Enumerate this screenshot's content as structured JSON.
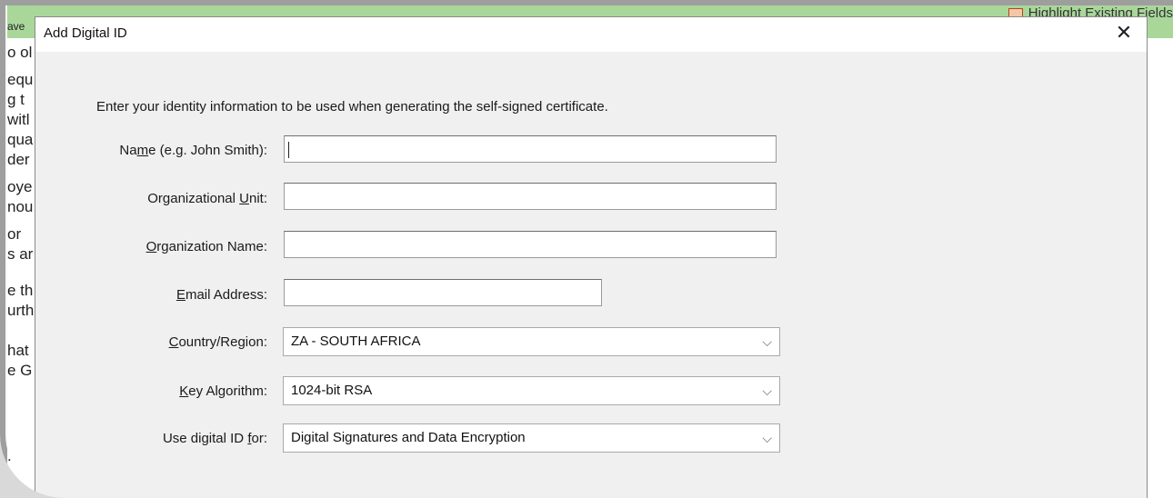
{
  "background": {
    "top_left_text": "ave",
    "highlight_button": "Highlight Existing Fields",
    "doc_lines": [
      "o ol",
      "equ",
      "g t",
      "witl",
      "qua",
      "der",
      "oye",
      "nou",
      "or",
      "s ar",
      "e th",
      "urth",
      "hat",
      "e G",
      "."
    ]
  },
  "dialog": {
    "title": "Add Digital ID",
    "close_symbol": "✕",
    "intro": "Enter your identity information to be used when generating the self-signed certificate.",
    "fields": {
      "name": {
        "label_pre": "Na",
        "label_u": "m",
        "label_post": "e (e.g. John Smith):",
        "value": ""
      },
      "org_unit": {
        "label_pre": "Organizational ",
        "label_u": "U",
        "label_post": "nit:",
        "value": ""
      },
      "org_name": {
        "label_pre": "",
        "label_u": "O",
        "label_post": "rganization Name:",
        "value": ""
      },
      "email": {
        "label_pre": "",
        "label_u": "E",
        "label_post": "mail Address:",
        "value": ""
      }
    },
    "selects": {
      "country": {
        "label_pre": "",
        "label_u": "C",
        "label_post": "ountry/Region:",
        "value": "ZA - SOUTH AFRICA"
      },
      "key_algorithm": {
        "label_pre": "",
        "label_u": "K",
        "label_post": "ey Algorithm:",
        "value": "1024-bit RSA"
      },
      "use_for": {
        "label_pre": "Use digital ID ",
        "label_u": "f",
        "label_post": "or:",
        "value": "Digital Signatures and Data Encryption"
      }
    },
    "chevron_symbol": "⌵"
  },
  "colors": {
    "top_bar": "#a9d79a",
    "dialog_bg": "#f0f0f0"
  }
}
